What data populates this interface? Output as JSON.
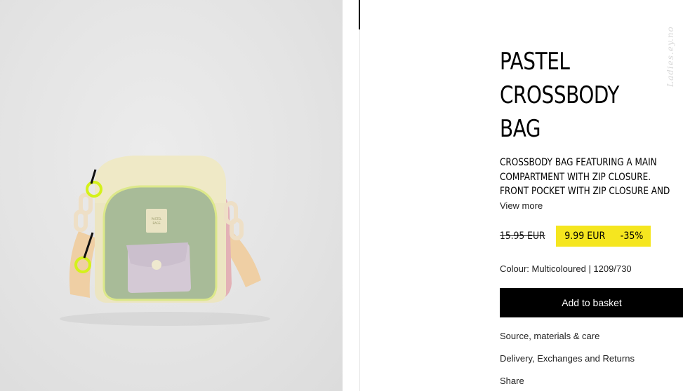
{
  "product": {
    "title_lines": [
      "PASTEL",
      "CROSSBODY",
      "BAG"
    ],
    "description_lines": [
      "CROSSBODY BAG FEATURING A MAIN",
      "COMPARTMENT WITH ZIP CLOSURE.",
      "FRONT POCKET WITH ZIP CLOSURE AND"
    ],
    "view_more": "View more",
    "old_price": "15.95 EUR",
    "sale_price": "9.99 EUR",
    "discount": "-35%",
    "colour": "Colour: Multicoloured | 1209/730",
    "add_to_basket": "Add to basket",
    "links": {
      "materials": "Source, materials & care",
      "delivery": "Delivery, Exchanges and Returns",
      "share": "Share"
    }
  },
  "image": {
    "label_text": "PASTEL BAGS",
    "watermark": "Ladies.ey.no"
  },
  "colors": {
    "sale_highlight": "#f5e61f",
    "button_bg": "#000000",
    "bag_cream": "#efe8c8",
    "bag_sage": "#a9bd99",
    "bag_lilac": "#d5cbd6",
    "bag_pink": "#e6b6ba",
    "bag_strap": "#f0d0a6",
    "bag_neon": "#d6f219"
  }
}
